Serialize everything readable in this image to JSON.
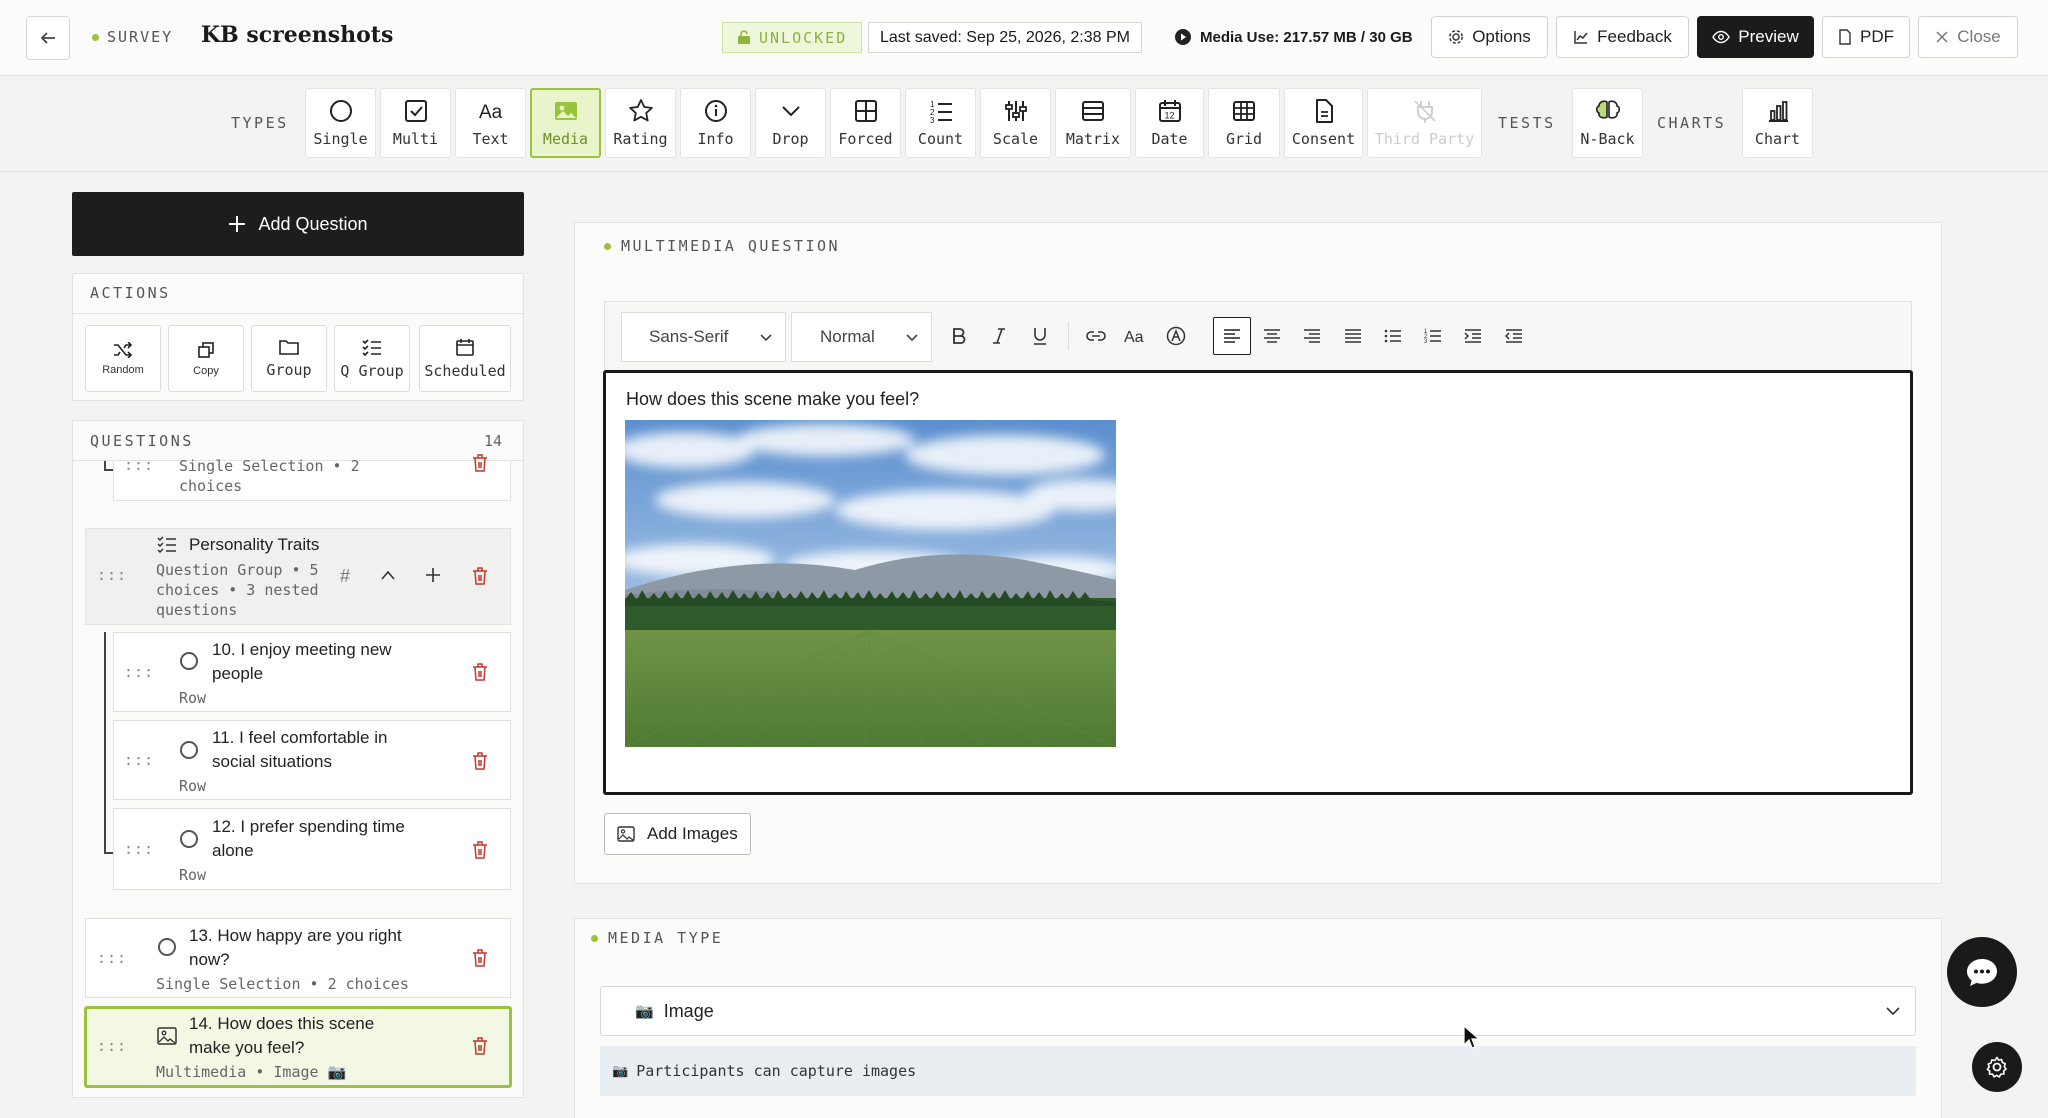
{
  "header": {
    "back_icon": "arrow-left-icon",
    "survey_tag": "SURVEY",
    "title": "KB screenshots",
    "lock_status": "UNLOCKED",
    "last_saved": "Last saved: Sep 25, 2026, 2:38 PM",
    "media_use": "Media Use: 217.57 MB / 30 GB",
    "buttons": {
      "options": "Options",
      "feedback": "Feedback",
      "preview": "Preview",
      "pdf": "PDF",
      "close": "Close"
    }
  },
  "types_bar": {
    "types_label": "TYPES",
    "tests_label": "TESTS",
    "charts_label": "CHARTS",
    "types": [
      "Single",
      "Multi",
      "Text",
      "Media",
      "Rating",
      "Info",
      "Drop",
      "Forced",
      "Count",
      "Scale",
      "Matrix",
      "Date",
      "Grid",
      "Consent",
      "Third Party"
    ],
    "active_type": "Media",
    "date_icon_number": "12",
    "tests": [
      "N-Back"
    ],
    "charts": [
      "Chart"
    ]
  },
  "left_panel": {
    "add_question": "Add Question",
    "actions_label": "ACTIONS",
    "actions": [
      "Random",
      "Copy",
      "Group",
      "Q Group",
      "Scheduled"
    ],
    "questions_label": "QUESTIONS",
    "questions_count": "14",
    "items": [
      {
        "title": "",
        "sub": "Single Selection • 2 choices"
      },
      {
        "title": "Personality Traits",
        "sub": "Question Group • 5 choices • 3 nested questions"
      },
      {
        "title": "10. I enjoy meeting new people",
        "sub": "Row"
      },
      {
        "title": "11. I feel comfortable in social situations",
        "sub": "Row"
      },
      {
        "title": "12. I prefer spending time alone",
        "sub": "Row"
      },
      {
        "title": "13. How happy are you right now?",
        "sub": "Single Selection • 2 choices"
      },
      {
        "title": "14. How does this scene make you feel?",
        "sub": "Multimedia • Image 📷"
      }
    ]
  },
  "editor": {
    "section_label": "MULTIMEDIA QUESTION",
    "font_select": "Sans-Serif",
    "size_select": "Normal",
    "question_text": "How does this scene make you feel?",
    "add_images": "Add Images"
  },
  "media_type": {
    "section_label": "MEDIA TYPE",
    "selected": "Image",
    "selected_icon": "📷",
    "info": "Participants can capture images",
    "info_icon": "📷"
  },
  "colors": {
    "accent": "#9bc23c",
    "dark": "#1b1b1b",
    "danger": "#c0392b"
  }
}
